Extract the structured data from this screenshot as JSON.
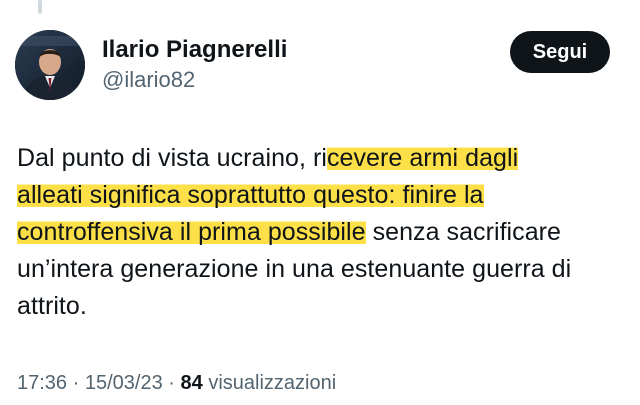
{
  "author": {
    "name": "Ilario Piagnerelli",
    "handle": "@ilario82"
  },
  "follow_button": {
    "label": "Segui"
  },
  "tweet": {
    "lines": [
      {
        "before": "Dal punto di vista ucraino, ri",
        "highlight": "cevere armi dagli",
        "after": ""
      },
      {
        "before": "",
        "highlight": "alleati significa soprattutto questo: finire la",
        "after": ""
      },
      {
        "before": "",
        "highlight": "controffensiva il prima possibile",
        "after": " senza sacrificare"
      },
      {
        "before": "un’intera generazione in una estenuante guerra di",
        "highlight": "",
        "after": ""
      },
      {
        "before": "attrito.",
        "highlight": "",
        "after": ""
      }
    ]
  },
  "meta": {
    "time": "17:36",
    "separator1": "·",
    "date": "15/03/23",
    "separator2": "·",
    "views_count": "84",
    "views_label": "visualizzazioni"
  },
  "colors": {
    "text": "#0f1419",
    "secondary": "#536471",
    "highlight": "#fde047",
    "button": "#0f1419"
  },
  "icons": {
    "avatar": "profile-photo"
  }
}
